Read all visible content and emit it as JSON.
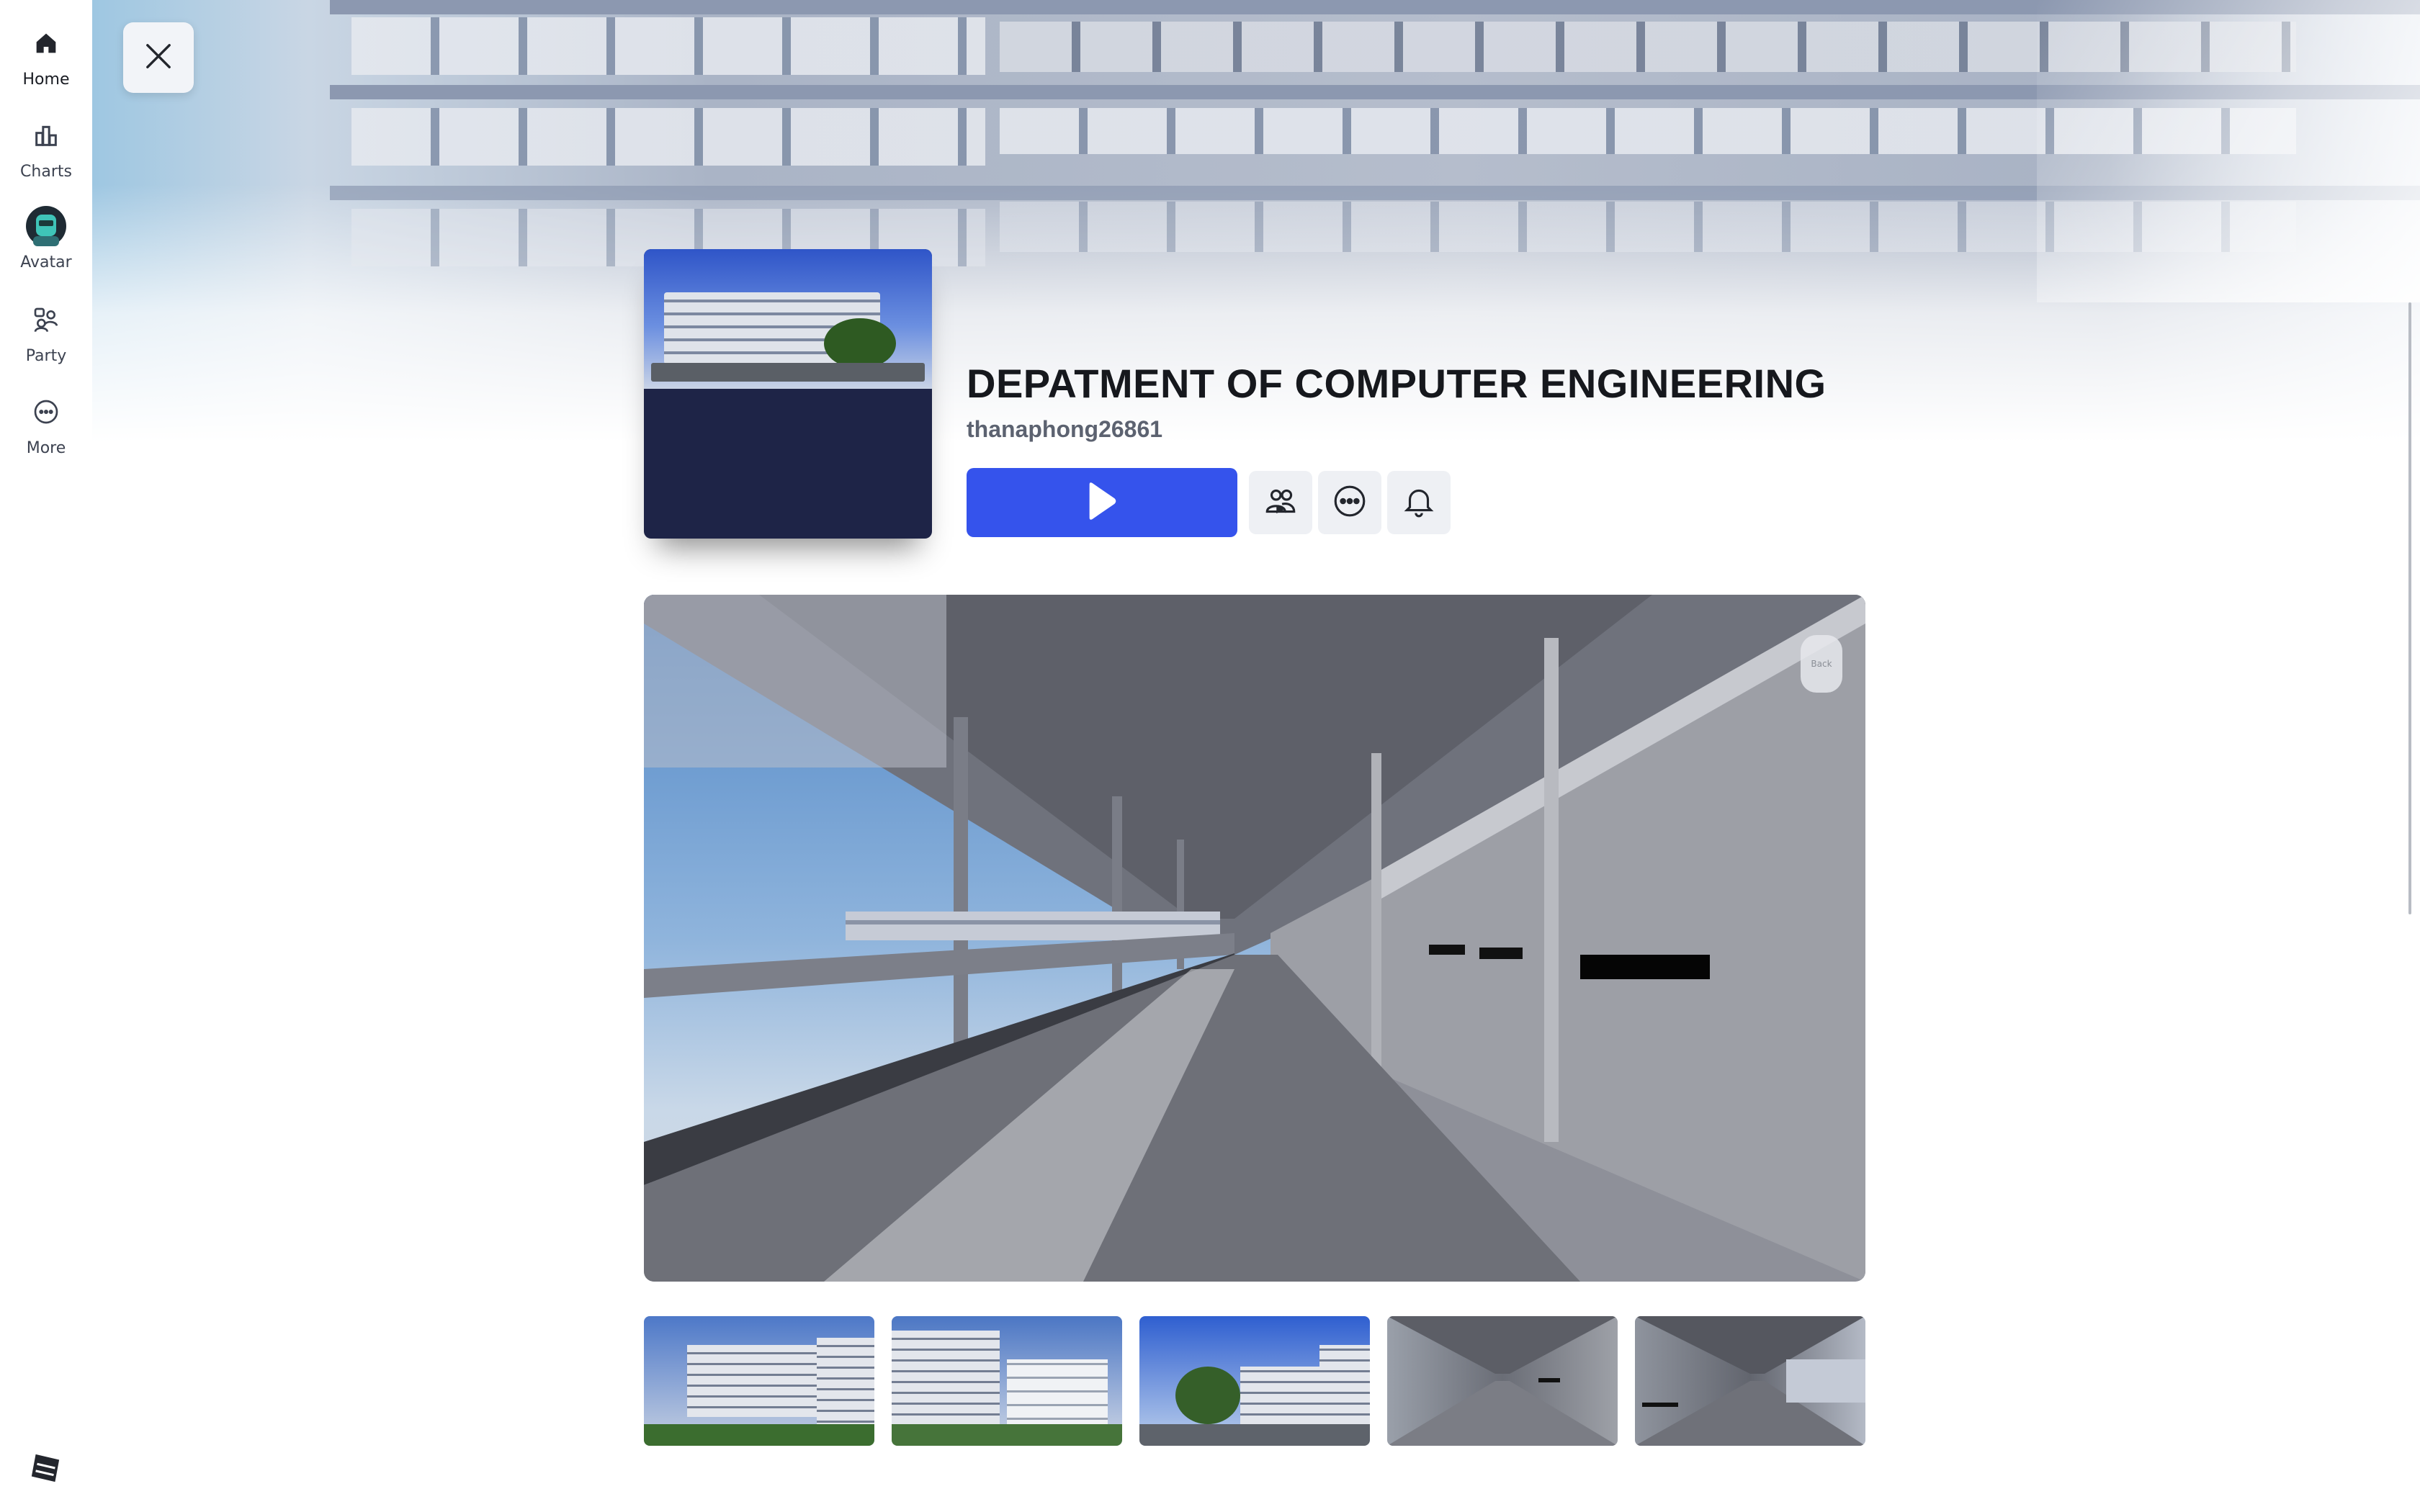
{
  "nav": {
    "items": [
      {
        "label": "Home",
        "icon": "home-icon"
      },
      {
        "label": "Charts",
        "icon": "charts-icon"
      },
      {
        "label": "Avatar",
        "icon": "avatar-icon"
      },
      {
        "label": "Party",
        "icon": "party-icon"
      },
      {
        "label": "More",
        "icon": "more-icon"
      }
    ],
    "active": "Home",
    "brand_icon": "roblox-logo-icon"
  },
  "header": {
    "close_icon": "close-icon"
  },
  "game": {
    "title": "DEPATMENT OF COMPUTER ENGINEERING",
    "creator": "thanaphong26861",
    "play_icon": "play-icon",
    "actions": [
      {
        "name": "play-with-friends",
        "icon": "friends-icon"
      },
      {
        "name": "more-options",
        "icon": "ellipsis-icon"
      },
      {
        "name": "notify",
        "icon": "bell-icon"
      }
    ]
  },
  "media": {
    "main_overlay_label": "Back",
    "thumbnail_count": 5
  },
  "colors": {
    "accent": "#3553ec",
    "nav_bg": "#ffffff",
    "button_bg": "#eef0f4",
    "thumb_bottom": "#1e2447"
  }
}
